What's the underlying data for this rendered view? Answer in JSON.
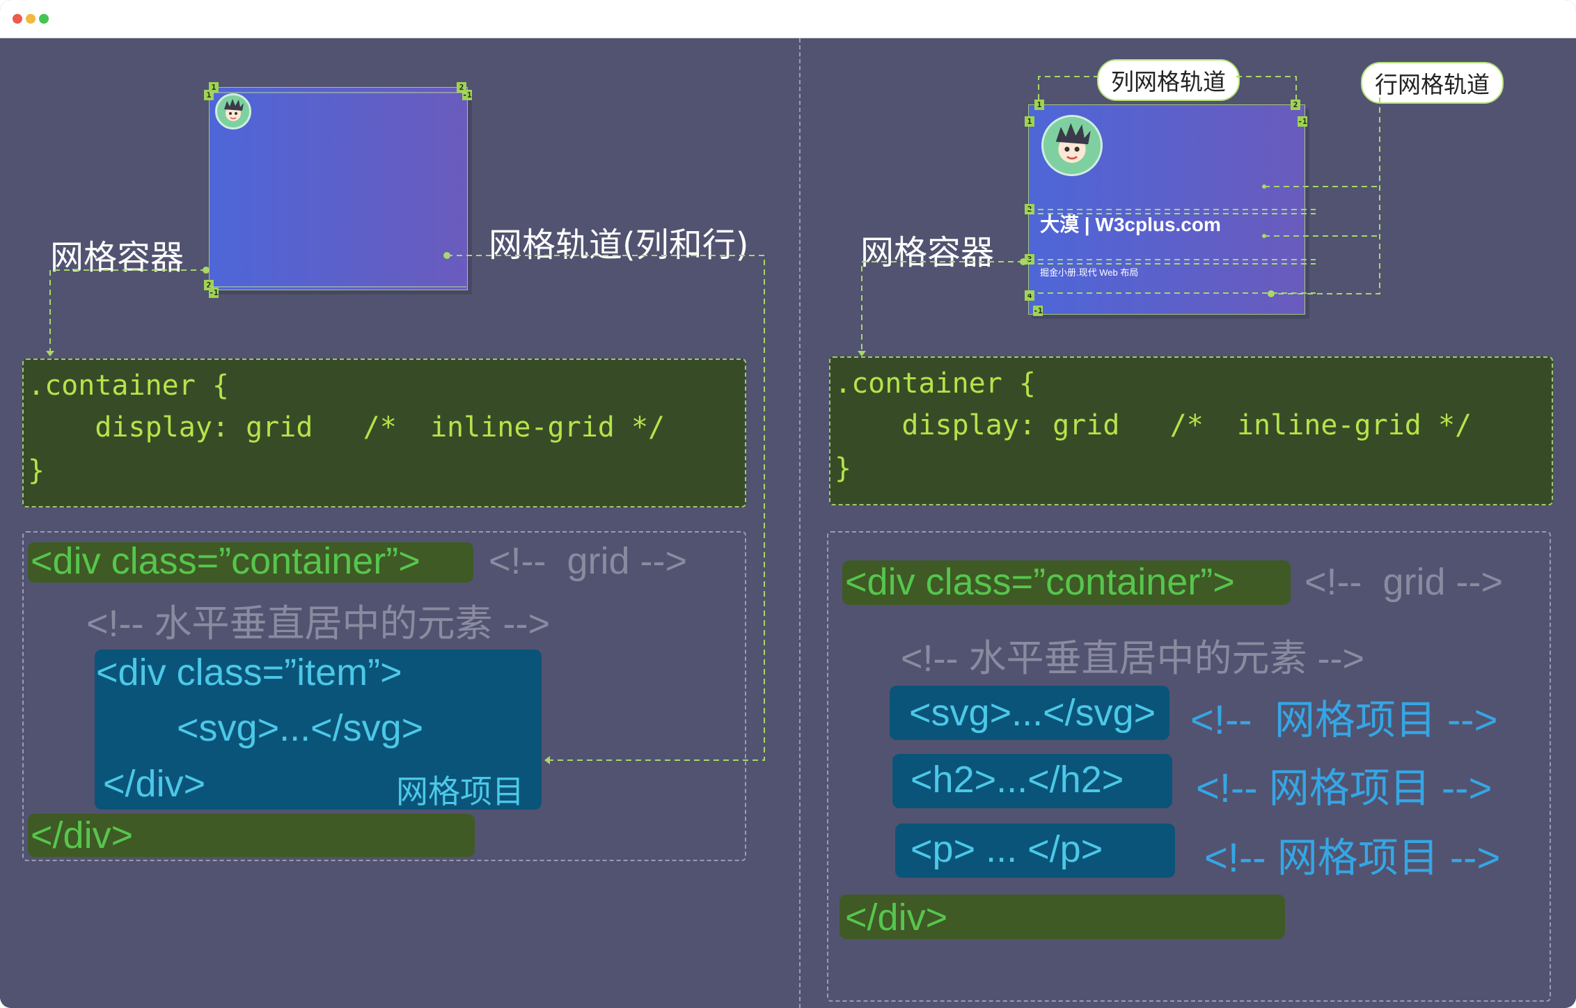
{
  "window": {
    "controls": [
      "close",
      "minimize",
      "maximize"
    ],
    "colors": {
      "close": "#ed5b4f",
      "minimize": "#f3b83f",
      "maximize": "#43c553"
    }
  },
  "left": {
    "label_container": "网格容器",
    "label_tracks": "网格轨道(列和行)",
    "line_tags": [
      "1",
      "1",
      "2",
      "-1",
      "2",
      "-1"
    ],
    "css": {
      "line1": ".container {",
      "line2": "    display: grid   /*  inline-grid */",
      "line3": "}"
    },
    "html": {
      "open_tag": "<div class=”container”>",
      "open_comment": "<!--  grid -->",
      "center_comment": "<!-- 水平垂直居中的元素 -->",
      "item_open": "<div class=”item”>",
      "svg": "<svg>...</svg>",
      "item_close": "</div>",
      "item_label": "网格项目",
      "close_tag": "</div>"
    }
  },
  "right": {
    "label_container": "网格容器",
    "label_columns": "列网格轨道",
    "label_rows": "行网格轨道",
    "card_title": "大漠 | W3cplus.com",
    "card_subtitle": "掘金小册.现代 Web 布局",
    "line_tags": [
      "1",
      "2",
      "1",
      "-1",
      "2",
      "3",
      "4",
      "-1"
    ],
    "css": {
      "line1": ".container {",
      "line2": "    display: grid   /*  inline-grid */",
      "line3": "}"
    },
    "html": {
      "open_tag": "<div class=”container”>",
      "open_comment": "<!--  grid -->",
      "center_comment": "<!-- 水平垂直居中的元素 -->",
      "svg": "<svg>...</svg>",
      "svg_comment": "<!--  网格项目 -->",
      "h2": "<h2>...</h2>",
      "h2_comment": "<!-- 网格项目 -->",
      "p": "<p> ... </p>",
      "p_comment": "<!-- 网格项目 -->",
      "close_tag": "</div>"
    }
  }
}
